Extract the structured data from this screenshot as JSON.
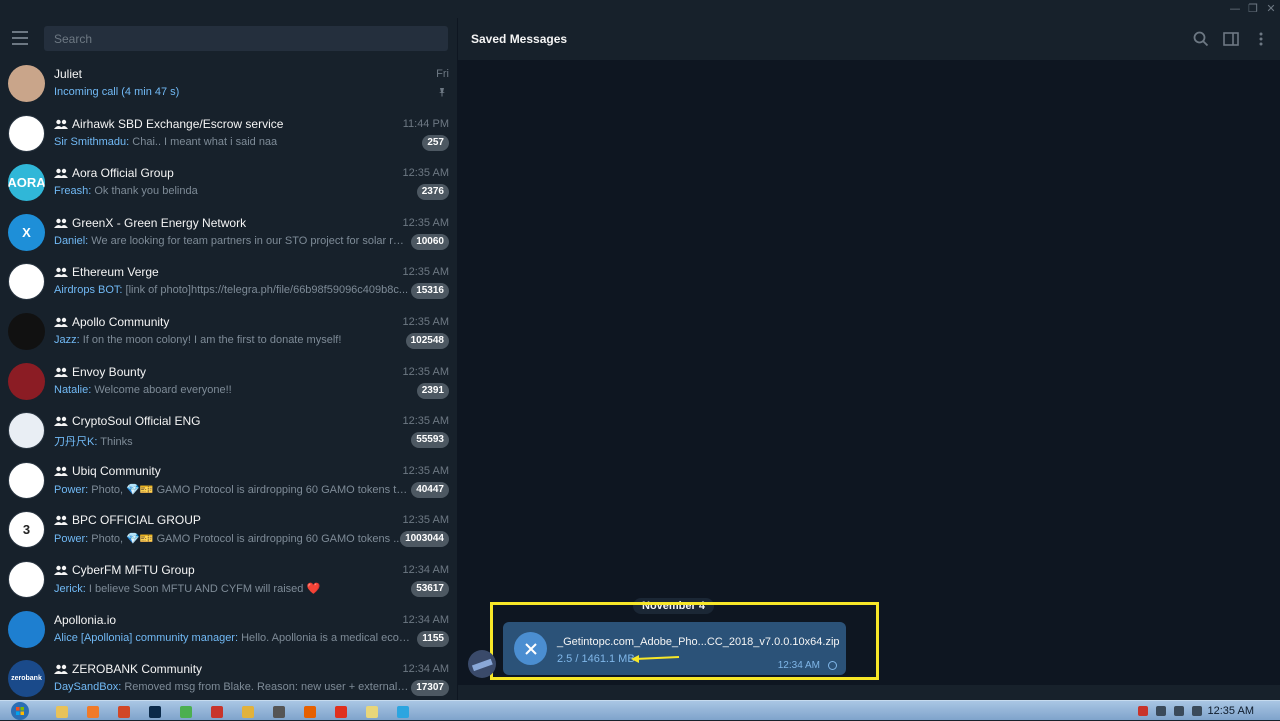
{
  "search": {
    "placeholder": "Search"
  },
  "window_controls": {
    "minimize": "—",
    "maximize": "❐",
    "close": "✕"
  },
  "chats": [
    {
      "name": "Juliet",
      "time": "Fri",
      "sender": "",
      "preview": "Incoming call (4 min 47 s)",
      "badge": "",
      "pinned": true,
      "group": false,
      "avatar_color": "#c9a58a",
      "avatar_text": ""
    },
    {
      "name": "Airhawk SBD Exchange/Escrow service",
      "time": "11:44 PM",
      "sender": "Sir Smithmadu:",
      "preview": " Chai.. I meant what i said naa",
      "badge": "257",
      "group": true,
      "avatar_color": "#ffffff",
      "avatar_text": ""
    },
    {
      "name": "Aora Official Group",
      "time": "12:35 AM",
      "sender": "Freash:",
      "preview": " Ok thank you belinda",
      "badge": "2376",
      "group": true,
      "avatar_color": "#30b7d8",
      "avatar_text": "AORA"
    },
    {
      "name": "GreenX - Green Energy Network",
      "time": "12:35 AM",
      "sender": "Daniel:",
      "preview": " We are looking for team partners in our STO project for solar rene...",
      "badge": "10060",
      "group": true,
      "avatar_color": "#1e8fd8",
      "avatar_text": "X"
    },
    {
      "name": "Ethereum Verge",
      "time": "12:35 AM",
      "sender": "Airdrops BOT:",
      "preview": " [link of photo]https://telegra.ph/file/66b98f59096c409b8c...",
      "badge": "15316",
      "group": true,
      "avatar_color": "#ffffff",
      "avatar_text": ""
    },
    {
      "name": "Apollo Community",
      "time": "12:35 AM",
      "sender": "Jazz:",
      "preview": " If on the moon colony! I am the first to donate myself!",
      "badge": "102548",
      "group": true,
      "avatar_color": "#111111",
      "avatar_text": ""
    },
    {
      "name": "Envoy Bounty",
      "time": "12:35 AM",
      "sender": "Natalie:",
      "preview": " Welcome aboard everyone!!",
      "badge": "2391",
      "group": true,
      "avatar_color": "#8b1c24",
      "avatar_text": ""
    },
    {
      "name": "CryptoSoul Official ENG",
      "time": "12:35 AM",
      "sender": "刀丹尺K:",
      "preview": " Thinks",
      "badge": "55593",
      "group": true,
      "avatar_color": "#e9eef4",
      "avatar_text": ""
    },
    {
      "name": "Ubiq Community",
      "time": "12:35 AM",
      "sender": "Power:",
      "preview": " Photo, 💎🎫 GAMO Protocol is airdropping 60 GAMO  tokens to ...",
      "badge": "40447",
      "group": true,
      "avatar_color": "#ffffff",
      "avatar_text": ""
    },
    {
      "name": "BPC OFFICIAL GROUP",
      "time": "12:35 AM",
      "sender": "Power:",
      "preview": " Photo, 💎🎫 GAMO Protocol is airdropping 60 GAMO  tokens ...",
      "badge": "1003044",
      "group": true,
      "avatar_color": "#ffffff",
      "avatar_text": "3"
    },
    {
      "name": "CyberFM MFTU Group",
      "time": "12:34 AM",
      "sender": "Jerick:",
      "preview": " I believe Soon MFTU AND CYFM will raised ❤️",
      "badge": "53617",
      "group": true,
      "avatar_color": "#ffffff",
      "avatar_text": ""
    },
    {
      "name": "Apollonia.io",
      "time": "12:34 AM",
      "sender": "Alice [Apollonia] community manager:",
      "preview": " Hello. Apollonia is a medical ecosyst...",
      "badge": "1155",
      "group": false,
      "avatar_color": "#1e7fd0",
      "avatar_text": ""
    },
    {
      "name": "ZEROBANK Community",
      "time": "12:34 AM",
      "sender": "DaySandBox:",
      "preview": " Removed msg from Blake. Reason: new user + external link",
      "badge": "17307",
      "group": true,
      "avatar_color": "#1a4a8a",
      "avatar_text": "zerobank"
    }
  ],
  "conversation": {
    "title": "Saved Messages",
    "date": "November 4",
    "file": {
      "name": "_Getintopc.com_Adobe_Pho...CC_2018_v7.0.0.10x64.zip",
      "progress": "2.5 / 1461.1 MB",
      "time": "12:34 AM"
    }
  },
  "taskbar": {
    "clock": "12:35 AM",
    "apps": [
      {
        "name": "explorer",
        "color": "#e8c25a"
      },
      {
        "name": "chrome-orange",
        "color": "#f07a28"
      },
      {
        "name": "office",
        "color": "#d24726"
      },
      {
        "name": "photoshop",
        "color": "#0b2a4a"
      },
      {
        "name": "green-app",
        "color": "#4caf50"
      },
      {
        "name": "red-app",
        "color": "#c8342b"
      },
      {
        "name": "chrome",
        "color": "#e2b23c"
      },
      {
        "name": "app-gray",
        "color": "#555555"
      },
      {
        "name": "firefox",
        "color": "#e66000"
      },
      {
        "name": "app-14",
        "color": "#e0301e"
      },
      {
        "name": "folder",
        "color": "#e8d67a"
      },
      {
        "name": "telegram",
        "color": "#2ca5e0"
      }
    ]
  }
}
